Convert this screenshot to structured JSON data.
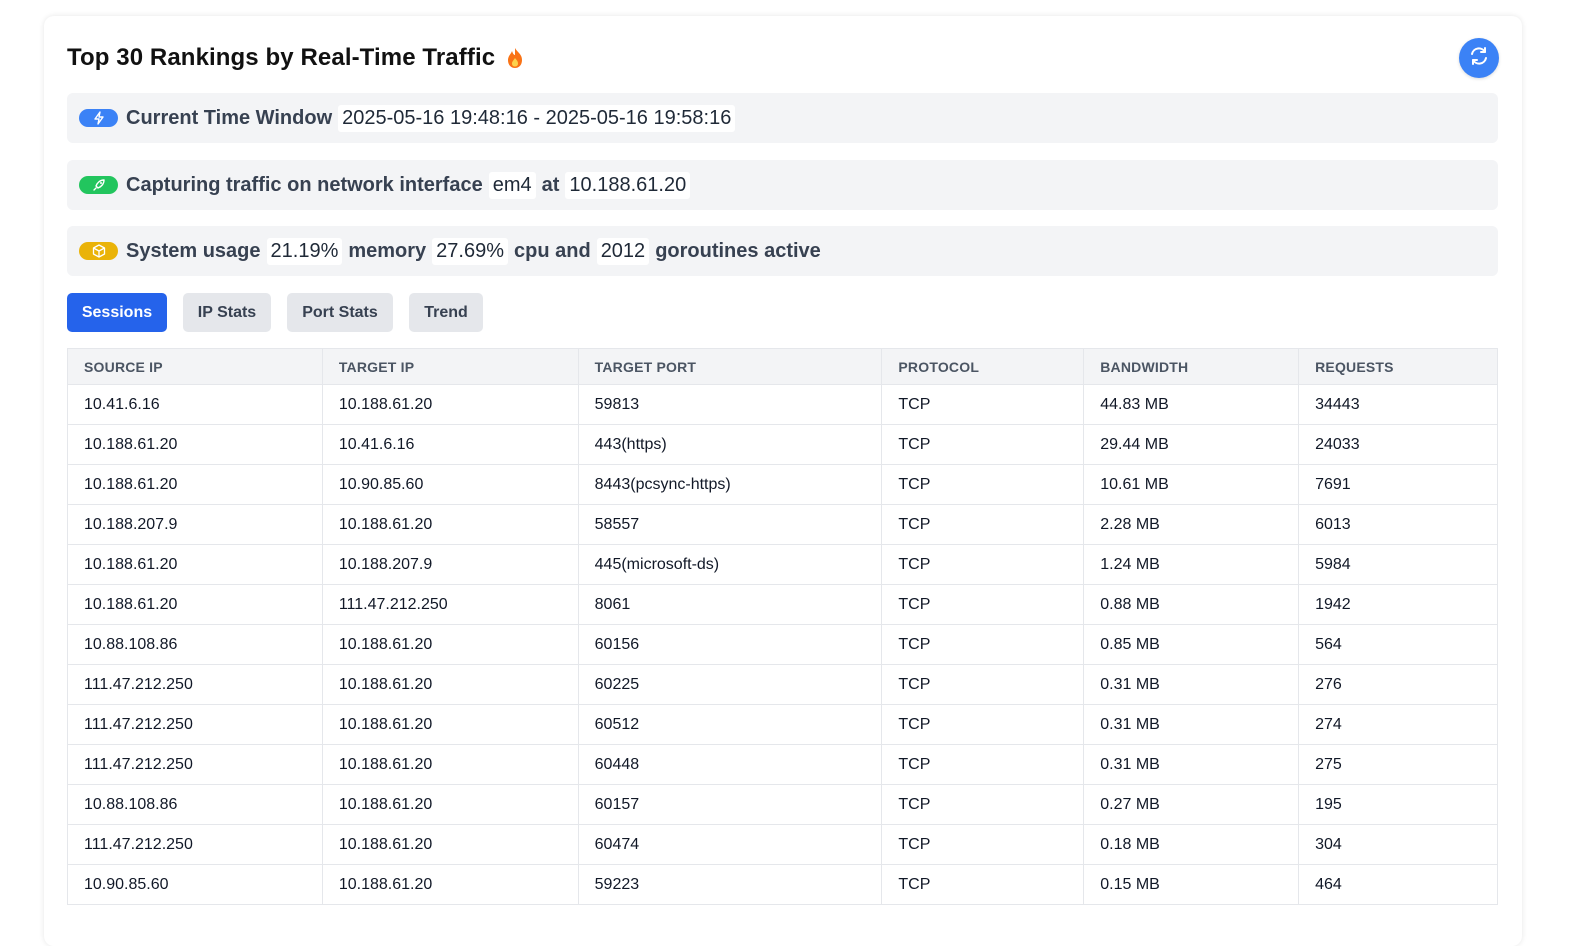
{
  "header": {
    "title": "Top 30 Rankings by Real-Time Traffic"
  },
  "time_window": {
    "label": "Current Time Window",
    "value": "2025-05-16 19:48:16 - 2025-05-16 19:58:16"
  },
  "capture": {
    "label": "Capturing traffic on network interface",
    "interface": "em4",
    "at_label": "at",
    "ip": "10.188.61.20"
  },
  "system": {
    "label": "System usage",
    "memory_value": "21.19%",
    "memory_label": "memory",
    "cpu_value": "27.69%",
    "cpu_label": "cpu and",
    "goroutines_value": "2012",
    "goroutines_label": "goroutines active"
  },
  "tabs": [
    {
      "label": "Sessions",
      "active": true
    },
    {
      "label": "IP Stats",
      "active": false
    },
    {
      "label": "Port Stats",
      "active": false
    },
    {
      "label": "Trend",
      "active": false
    }
  ],
  "table": {
    "columns": [
      "SOURCE IP",
      "TARGET IP",
      "TARGET PORT",
      "PROTOCOL",
      "BANDWIDTH",
      "REQUESTS"
    ],
    "rows": [
      [
        "10.41.6.16",
        "10.188.61.20",
        "59813",
        "TCP",
        "44.83 MB",
        "34443"
      ],
      [
        "10.188.61.20",
        "10.41.6.16",
        "443(https)",
        "TCP",
        "29.44 MB",
        "24033"
      ],
      [
        "10.188.61.20",
        "10.90.85.60",
        "8443(pcsync-https)",
        "TCP",
        "10.61 MB",
        "7691"
      ],
      [
        "10.188.207.9",
        "10.188.61.20",
        "58557",
        "TCP",
        "2.28 MB",
        "6013"
      ],
      [
        "10.188.61.20",
        "10.188.207.9",
        "445(microsoft-ds)",
        "TCP",
        "1.24 MB",
        "5984"
      ],
      [
        "10.188.61.20",
        "111.47.212.250",
        "8061",
        "TCP",
        "0.88 MB",
        "1942"
      ],
      [
        "10.88.108.86",
        "10.188.61.20",
        "60156",
        "TCP",
        "0.85 MB",
        "564"
      ],
      [
        "111.47.212.250",
        "10.188.61.20",
        "60225",
        "TCP",
        "0.31 MB",
        "276"
      ],
      [
        "111.47.212.250",
        "10.188.61.20",
        "60512",
        "TCP",
        "0.31 MB",
        "274"
      ],
      [
        "111.47.212.250",
        "10.188.61.20",
        "60448",
        "TCP",
        "0.31 MB",
        "275"
      ],
      [
        "10.88.108.86",
        "10.188.61.20",
        "60157",
        "TCP",
        "0.27 MB",
        "195"
      ],
      [
        "111.47.212.250",
        "10.188.61.20",
        "60474",
        "TCP",
        "0.18 MB",
        "304"
      ],
      [
        "10.90.85.60",
        "10.188.61.20",
        "59223",
        "TCP",
        "0.15 MB",
        "464"
      ]
    ]
  },
  "colors": {
    "accent": "#2563eb",
    "refresh": "#3b82f6",
    "badge_time": "#3b82f6",
    "badge_capture": "#22c55e",
    "badge_system": "#eab308",
    "fire": "#f97316"
  },
  "icons": {
    "refresh": "refresh-icon",
    "fire": "fire-icon",
    "time": "lightning-icon",
    "capture": "rocket-icon",
    "system": "cube-icon"
  }
}
